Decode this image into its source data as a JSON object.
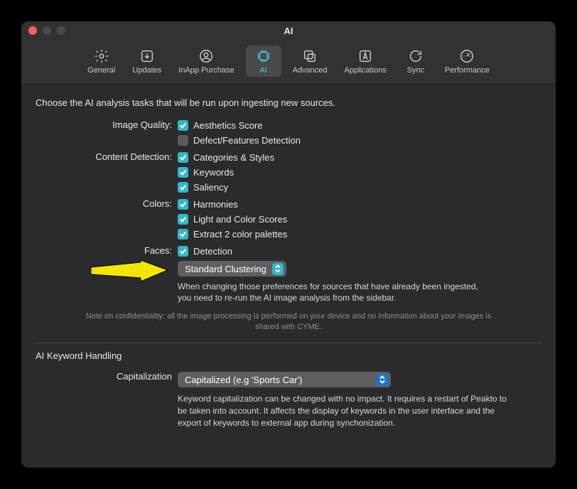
{
  "window": {
    "title": "AI"
  },
  "toolbar": {
    "items": [
      {
        "label": "General"
      },
      {
        "label": "Updates"
      },
      {
        "label": "InApp Purchase"
      },
      {
        "label": "AI"
      },
      {
        "label": "Advanced"
      },
      {
        "label": "Applications"
      },
      {
        "label": "Sync"
      },
      {
        "label": "Performance"
      }
    ]
  },
  "intro": "Choose the AI analysis tasks that will be run upon ingesting new sources.",
  "groups": {
    "imageQuality": {
      "label": "Image Quality:",
      "items": [
        "Aesthetics Score",
        "Defect/Features Detection"
      ]
    },
    "contentDetection": {
      "label": "Content Detection:",
      "items": [
        "Categories & Styles",
        "Keywords",
        "Saliency"
      ]
    },
    "colors": {
      "label": "Colors:",
      "items": [
        "Harmonies",
        "Light and Color Scores",
        "Extract 2 color palettes"
      ]
    },
    "faces": {
      "label": "Faces:",
      "items": [
        "Detection"
      ],
      "clustering": "Standard Clustering"
    }
  },
  "note_rerun": "When changing those preferences for sources that have already been ingested, you need to re-run the AI image analysis from the sidebar.",
  "note_conf": "Note on confidentiality: all the image processing is performed on your device and no information about your images is shared with CYME.",
  "keyword": {
    "section": "AI Keyword Handling",
    "cap_label": "Capitalization",
    "cap_value": "Capitalized (e.g 'Sports Car')",
    "note": "Keyword capitalization can be changed with no impact. It requires a restart of Peakto to be taken into account. It affects the display of keywords in the user interface and the export of keywords to external app during synchonization."
  }
}
